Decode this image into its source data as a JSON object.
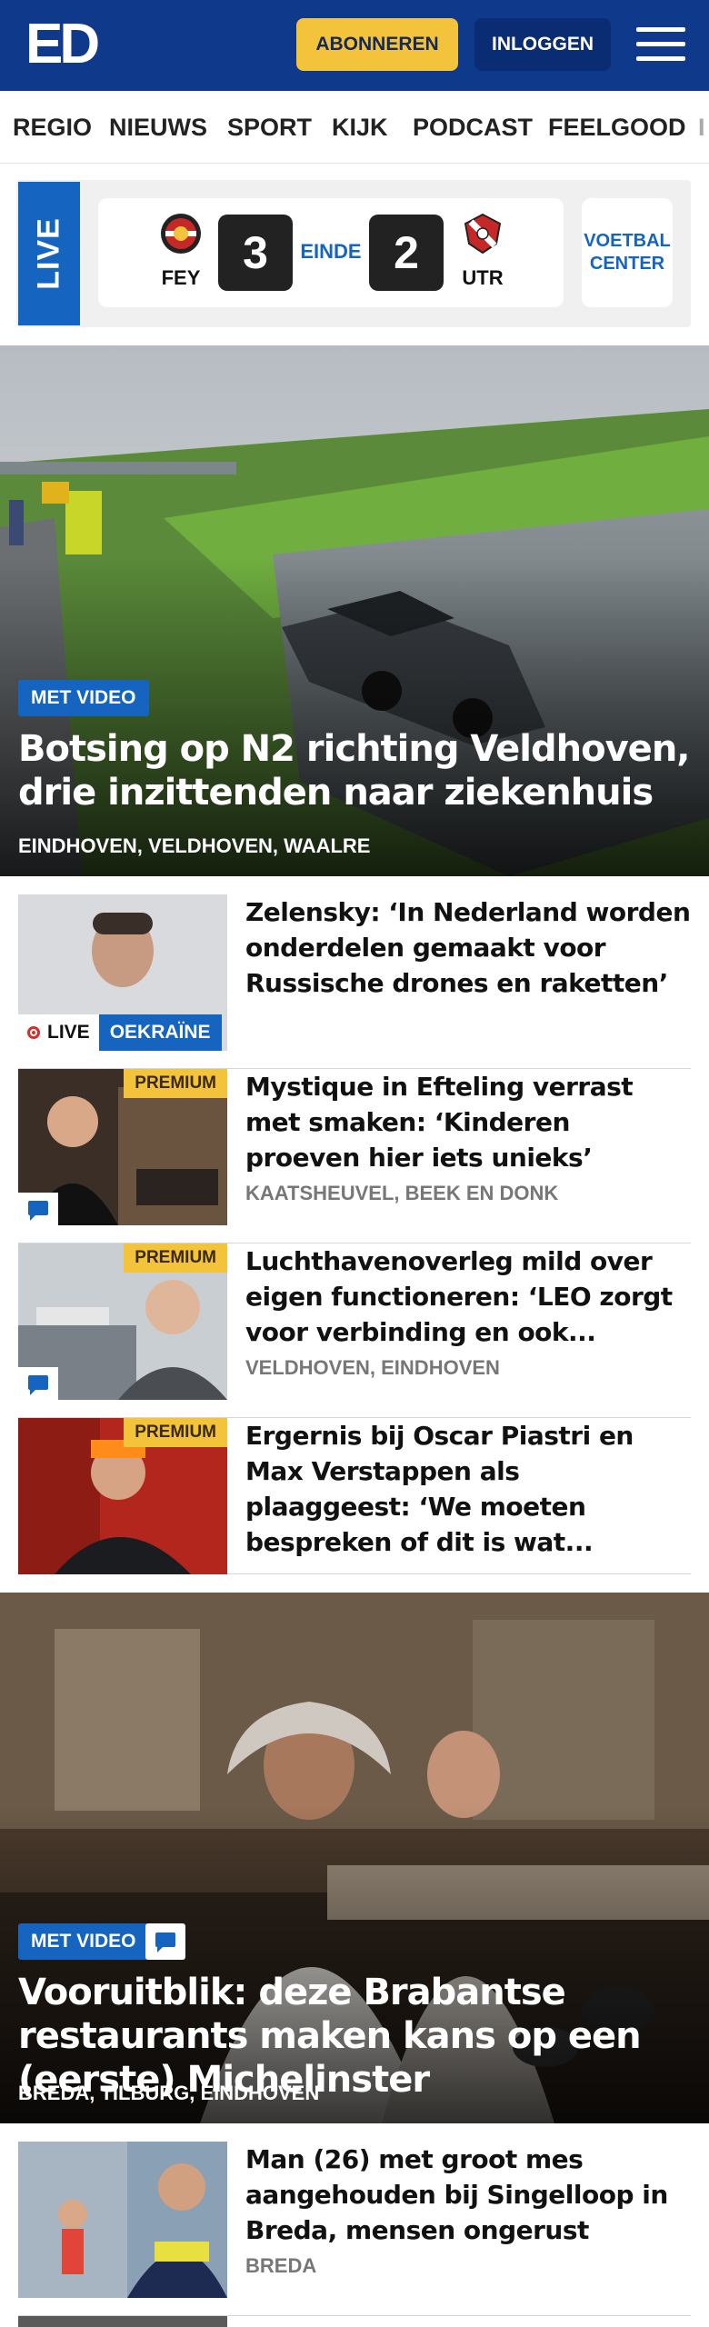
{
  "header": {
    "logo": "ED",
    "subscribe_label": "ABONNEREN",
    "login_label": "INLOGGEN"
  },
  "nav": {
    "items": [
      "REGIO",
      "NIEUWS",
      "SPORT",
      "KIJK",
      "PODCAST",
      "FEELGOOD",
      "I"
    ]
  },
  "live_score": {
    "live_label": "LIVE",
    "home_team": "FEY",
    "home_score": "3",
    "status": "EINDE",
    "away_score": "2",
    "away_team": "UTR",
    "center_button": "VOETBAL CENTER"
  },
  "hero1": {
    "video_tag": "MET VIDEO",
    "title": "Botsing op N2 richting Veldhoven, drie inzittenden naar ziekenhuis",
    "locations": "EINDHOVEN, VELDHOVEN, WAALRE"
  },
  "articles": [
    {
      "title": "Zelensky: ‘In Nederland worden onderdelen gemaakt voor Russische drones en raketten’",
      "live_label": "LIVE",
      "topic": "OEKRAÏNE"
    },
    {
      "title": "Mystique in Efteling verrast met smaken: ‘Kinderen proeven hier iets unieks’",
      "locations": "KAATSHEUVEL, BEEK EN DONK",
      "premium": "PREMIUM"
    },
    {
      "title": "Luchthavenoverleg mild over eigen functioneren: ‘LEO zorgt voor verbinding en ook...",
      "locations": "VELDHOVEN, EINDHOVEN",
      "premium": "PREMIUM"
    },
    {
      "title": "Ergernis bij Oscar Piastri en Max Verstappen als plaaggeest: ‘We moeten bespreken of dit is wat...",
      "premium": "PREMIUM"
    }
  ],
  "hero2": {
    "video_tag": "MET VIDEO",
    "title": "Vooruitblik: deze Brabantse restau­rants maken kans op een (eerste) Michelinster",
    "locations": "BREDA, TILBURG, EINDHOVEN"
  },
  "articles2": [
    {
      "title": "Man (26) met groot mes aangehouden bij Singelloop in Breda, mensen ongerust",
      "locations": "BREDA"
    }
  ],
  "colors": {
    "brand_blue": "#0f3a8c",
    "accent_blue": "#1565c0",
    "premium_yellow": "#f3c43b",
    "live_red": "#d32f2f"
  }
}
